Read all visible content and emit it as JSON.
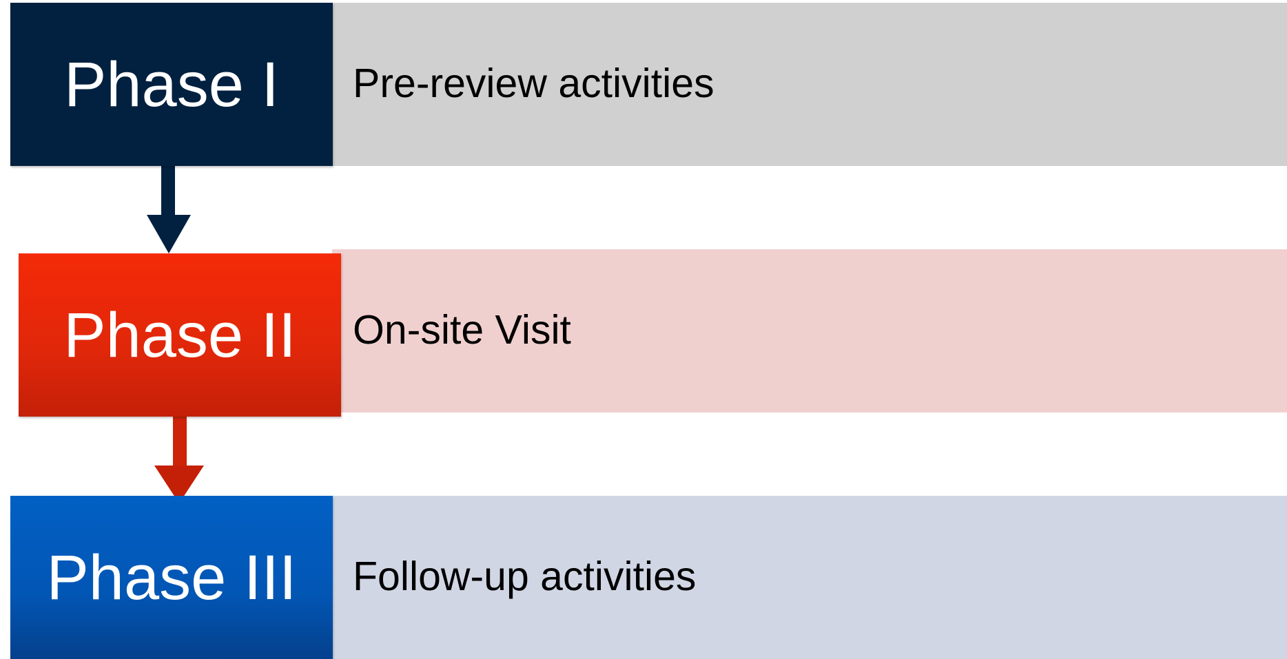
{
  "phases": [
    {
      "label": "Phase I",
      "description": "Pre-review activities",
      "box_color": "#022140",
      "band_color": "#d0d0d0"
    },
    {
      "label": "Phase II",
      "description": "On-site Visit",
      "box_color": "#e0270a",
      "band_color": "#f0d0cf"
    },
    {
      "label": "Phase III",
      "description": "Follow-up activities",
      "box_color": "#0256b4",
      "band_color": "#d0d6e4"
    }
  ],
  "arrows": [
    {
      "from": "Phase I",
      "to": "Phase II",
      "color": "#022140"
    },
    {
      "from": "Phase II",
      "to": "Phase III",
      "color": "#c42008"
    }
  ]
}
